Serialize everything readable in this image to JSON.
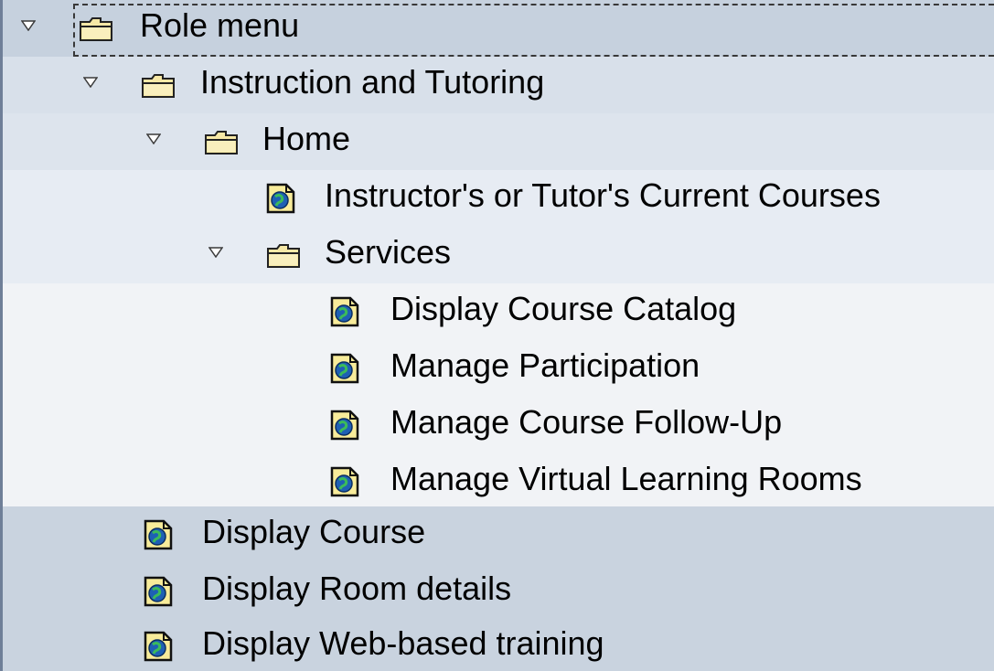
{
  "colors": {
    "level0_background": "#c6d1de",
    "level1_background": "#d8e0ea",
    "level2_background": "#e7ecf3",
    "level3_background": "#f1f3f6",
    "left_border": "#6f7f98",
    "folder_color": "#f6e8a6",
    "folder_outline": "#222222",
    "page_icon_fill": "#f8ec9a",
    "globe_color": "#1e60b4"
  },
  "tree": {
    "items": [
      {
        "label": "Role menu",
        "type": "folder",
        "expanded": true,
        "icon": "folder-icon",
        "toggle_icon": "triangle-down-icon"
      },
      {
        "label": "Instruction and Tutoring",
        "type": "folder",
        "expanded": true,
        "icon": "folder-icon",
        "toggle_icon": "triangle-down-icon"
      },
      {
        "label": "Home",
        "type": "folder",
        "expanded": true,
        "icon": "folder-icon",
        "toggle_icon": "triangle-down-icon"
      },
      {
        "label": "Instructor's or Tutor's Current Courses",
        "type": "service",
        "icon": "web-service-icon"
      },
      {
        "label": "Services",
        "type": "folder",
        "expanded": true,
        "icon": "folder-icon",
        "toggle_icon": "triangle-down-icon"
      },
      {
        "label": "Display Course Catalog",
        "type": "service",
        "icon": "web-service-icon"
      },
      {
        "label": "Manage Participation",
        "type": "service",
        "icon": "web-service-icon"
      },
      {
        "label": "Manage Course Follow-Up",
        "type": "service",
        "icon": "web-service-icon"
      },
      {
        "label": "Manage Virtual Learning Rooms",
        "type": "service",
        "icon": "web-service-icon"
      },
      {
        "label": "Display Course",
        "type": "service",
        "icon": "web-service-icon"
      },
      {
        "label": "Display Room details",
        "type": "service",
        "icon": "web-service-icon"
      },
      {
        "label": "Display Web-based training",
        "type": "service",
        "icon": "web-service-icon"
      }
    ]
  }
}
